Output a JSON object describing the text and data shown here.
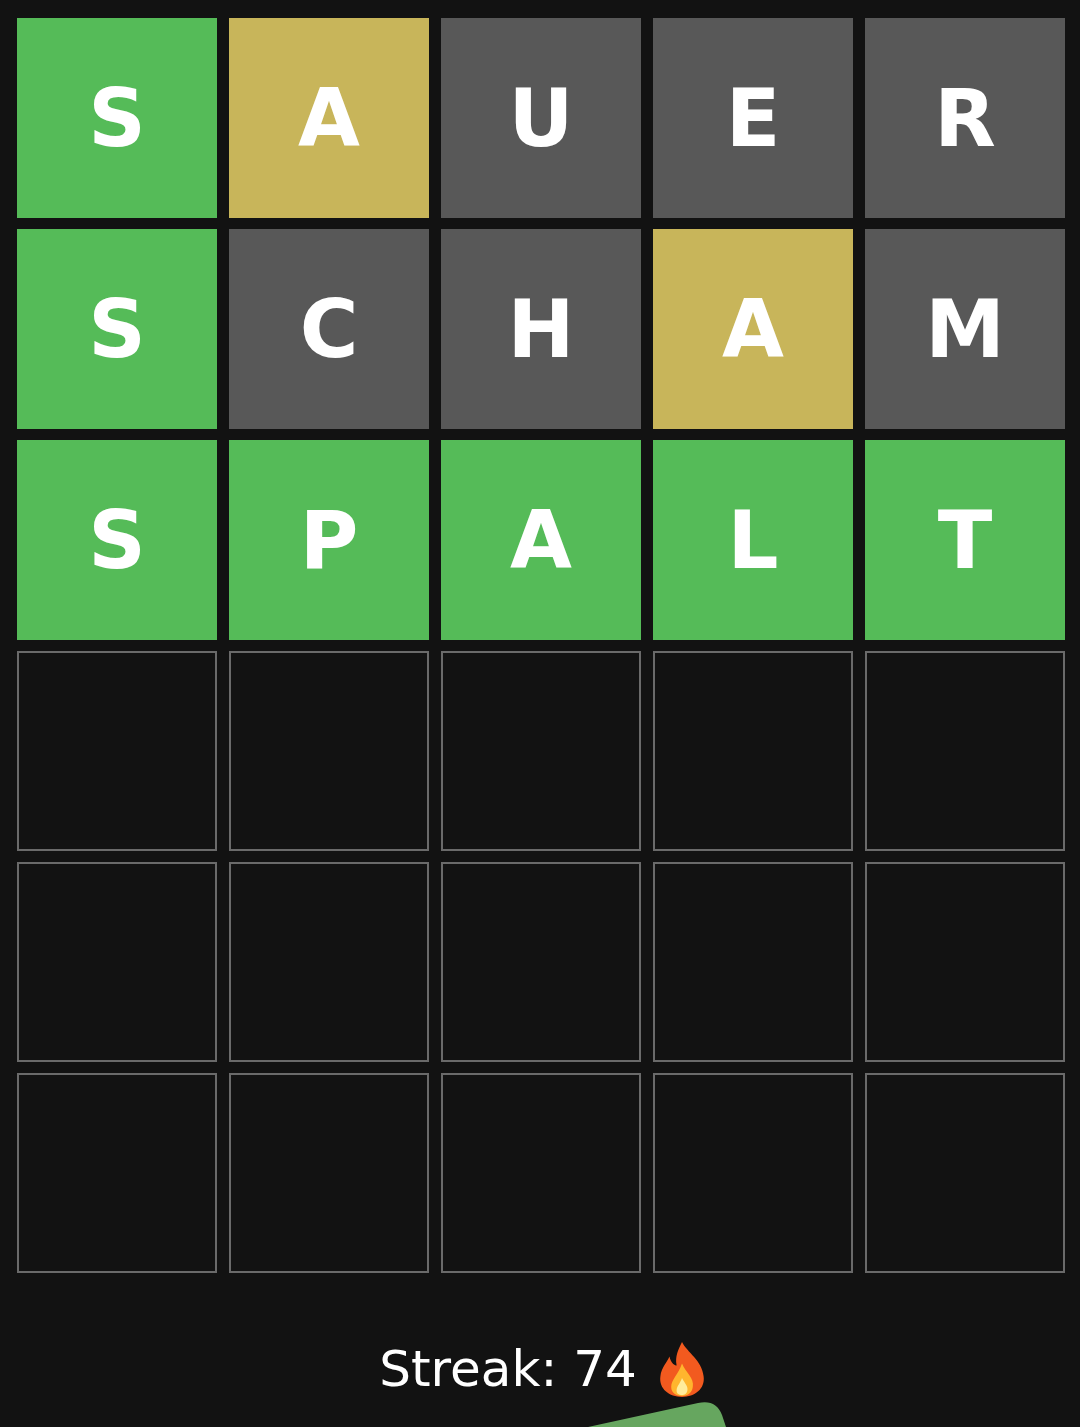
{
  "board": [
    {
      "tiles": [
        {
          "letter": "S",
          "kind": "correct"
        },
        {
          "letter": "A",
          "kind": "present"
        },
        {
          "letter": "U",
          "kind": "absent"
        },
        {
          "letter": "E",
          "kind": "absent"
        },
        {
          "letter": "R",
          "kind": "absent"
        }
      ]
    },
    {
      "tiles": [
        {
          "letter": "S",
          "kind": "correct"
        },
        {
          "letter": "C",
          "kind": "absent"
        },
        {
          "letter": "H",
          "kind": "absent"
        },
        {
          "letter": "A",
          "kind": "present"
        },
        {
          "letter": "M",
          "kind": "absent"
        }
      ]
    },
    {
      "tiles": [
        {
          "letter": "S",
          "kind": "correct"
        },
        {
          "letter": "P",
          "kind": "correct"
        },
        {
          "letter": "A",
          "kind": "correct"
        },
        {
          "letter": "L",
          "kind": "correct"
        },
        {
          "letter": "T",
          "kind": "correct"
        }
      ]
    },
    {
      "tiles": [
        {
          "kind": "empty"
        },
        {
          "kind": "empty"
        },
        {
          "kind": "empty"
        },
        {
          "kind": "empty"
        },
        {
          "kind": "empty"
        }
      ]
    },
    {
      "tiles": [
        {
          "kind": "empty"
        },
        {
          "kind": "empty"
        },
        {
          "kind": "empty"
        },
        {
          "kind": "empty"
        },
        {
          "kind": "empty"
        }
      ]
    },
    {
      "tiles": [
        {
          "kind": "empty"
        },
        {
          "kind": "empty"
        },
        {
          "kind": "empty"
        },
        {
          "kind": "empty"
        },
        {
          "kind": "empty"
        }
      ]
    }
  ],
  "streak": {
    "label": "Streak: 74"
  }
}
